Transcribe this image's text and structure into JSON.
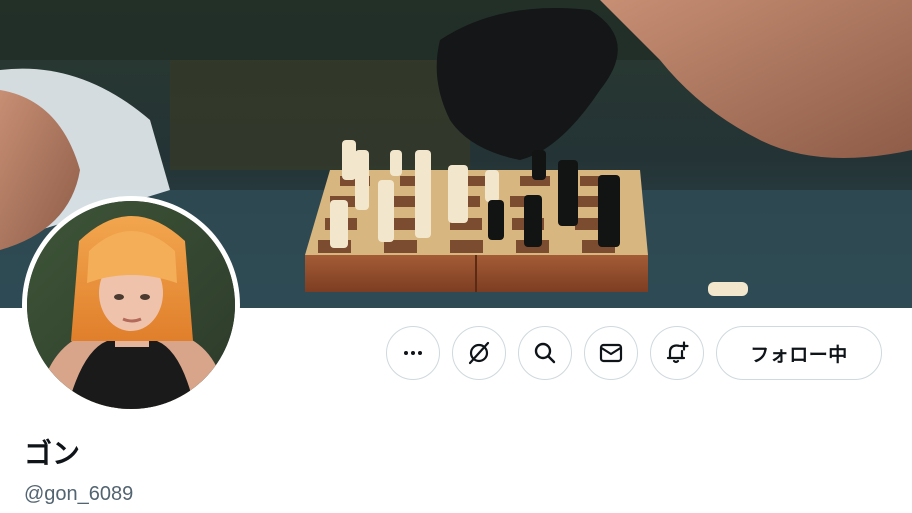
{
  "profile": {
    "display_name": "ゴン",
    "handle": "@gon_6089"
  },
  "banner": {
    "description_icon": "chess-banner-image"
  },
  "avatar": {
    "icon": "avatar-image"
  },
  "actions": {
    "more_icon": "more-icon",
    "grok_icon": "grok-icon",
    "search_icon": "search-icon",
    "message_icon": "message-icon",
    "notify_icon": "bell-plus-icon",
    "follow_label": "フォロー中"
  },
  "colors": {
    "text_primary": "#0f1419",
    "text_secondary": "#536471",
    "button_border": "#cfd9de",
    "background": "#ffffff"
  }
}
